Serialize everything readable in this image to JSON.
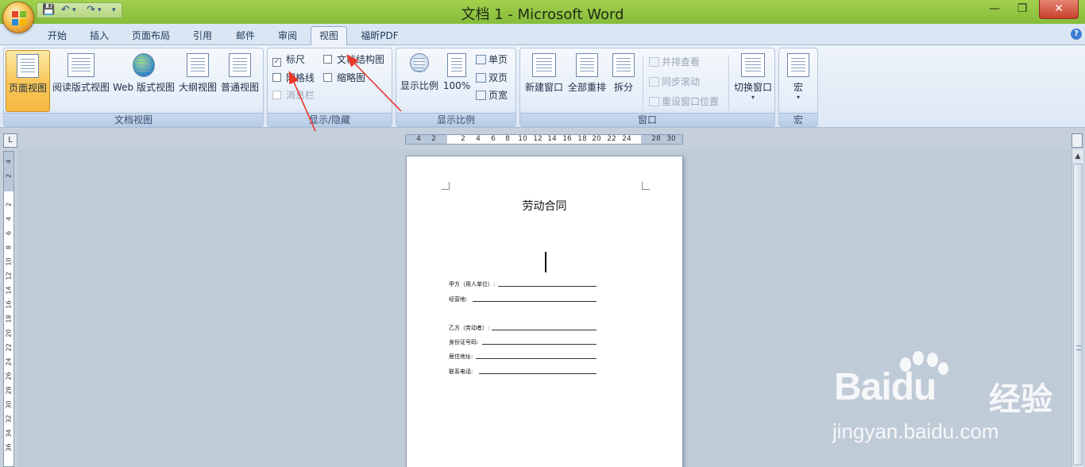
{
  "window": {
    "title": "文档 1 - Microsoft Word",
    "minimize": "—",
    "maximize": "❐",
    "close": "✕"
  },
  "qat": {
    "save": "💾",
    "undo": "↶",
    "undo_dd": "▾",
    "redo": "↷",
    "redo_dd": "▾",
    "customize": "▾"
  },
  "tabs": [
    "开始",
    "插入",
    "页面布局",
    "引用",
    "邮件",
    "审阅",
    "视图",
    "福昕PDF"
  ],
  "active_tab": "视图",
  "help": "?",
  "ribbon": {
    "doc_views": {
      "label": "文档视图",
      "buttons": [
        "页面视图",
        "阅读版式视图",
        "Web 版式视图",
        "大纲视图",
        "普通视图"
      ]
    },
    "show_hide": {
      "label": "显示/隐藏",
      "ruler": "标尺",
      "gridlines": "网格线",
      "message_bar": "消息栏",
      "doc_map": "文档结构图",
      "thumbnails": "缩略图"
    },
    "zoom": {
      "label": "显示比例",
      "zoom": "显示比例",
      "percent": "100%",
      "one_page": "单页",
      "two_pages": "双页",
      "page_width": "页宽"
    },
    "window": {
      "label": "窗口",
      "new_window": "新建窗口",
      "arrange_all": "全部重排",
      "split": "拆分",
      "side_by_side": "并排查看",
      "sync_scroll": "同步滚动",
      "reset_position": "重设窗口位置",
      "switch_windows": "切换窗口"
    },
    "macros": {
      "label": "宏",
      "macros": "宏"
    }
  },
  "ruler": {
    "corner": "L",
    "h_numbers": [
      "4",
      "2",
      "2",
      "4",
      "6",
      "8",
      "10",
      "12",
      "14",
      "16",
      "18",
      "20",
      "22",
      "24",
      "28",
      "30"
    ],
    "v_numbers": [
      "4",
      "2",
      "2",
      "4",
      "6",
      "8",
      "10",
      "12",
      "14",
      "16",
      "18",
      "20",
      "22",
      "24",
      "26",
      "28",
      "30",
      "32",
      "34",
      "36"
    ]
  },
  "document": {
    "title": "劳动合同",
    "fields": [
      "甲方（用人单位）:",
      "经营地:",
      "乙方（劳动者）:",
      "身份证号码:",
      "居住地址:",
      "联系电话:"
    ]
  },
  "watermark": {
    "brand": "Bai",
    "brand_du": "du",
    "cn": "经验",
    "url": "jingyan.baidu.com"
  },
  "colors": {
    "title_bar": "#a2d04d",
    "ribbon_bg": "#dde7f4",
    "active_view": "#f9c75a",
    "arrow": "#e8382c"
  }
}
